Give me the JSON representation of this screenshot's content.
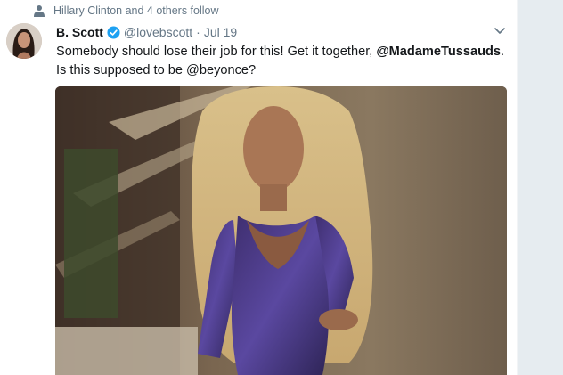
{
  "context": {
    "text": "Hillary Clinton and 4 others follow",
    "icon": "person-icon"
  },
  "tweet": {
    "author_name": "B. Scott",
    "verified": true,
    "handle": "@lovebscott",
    "separator": "·",
    "date": "Jul 19",
    "text_part1": "Somebody should lose their job for this! Get it together, ",
    "mention1": "@MadameTussauds",
    "text_part2": ". Is this supposed to be ",
    "mention2": "@beyonce",
    "text_part3": "?"
  },
  "colors": {
    "accent": "#1da1f2",
    "muted": "#657786",
    "rail": "#e6ecf0"
  }
}
